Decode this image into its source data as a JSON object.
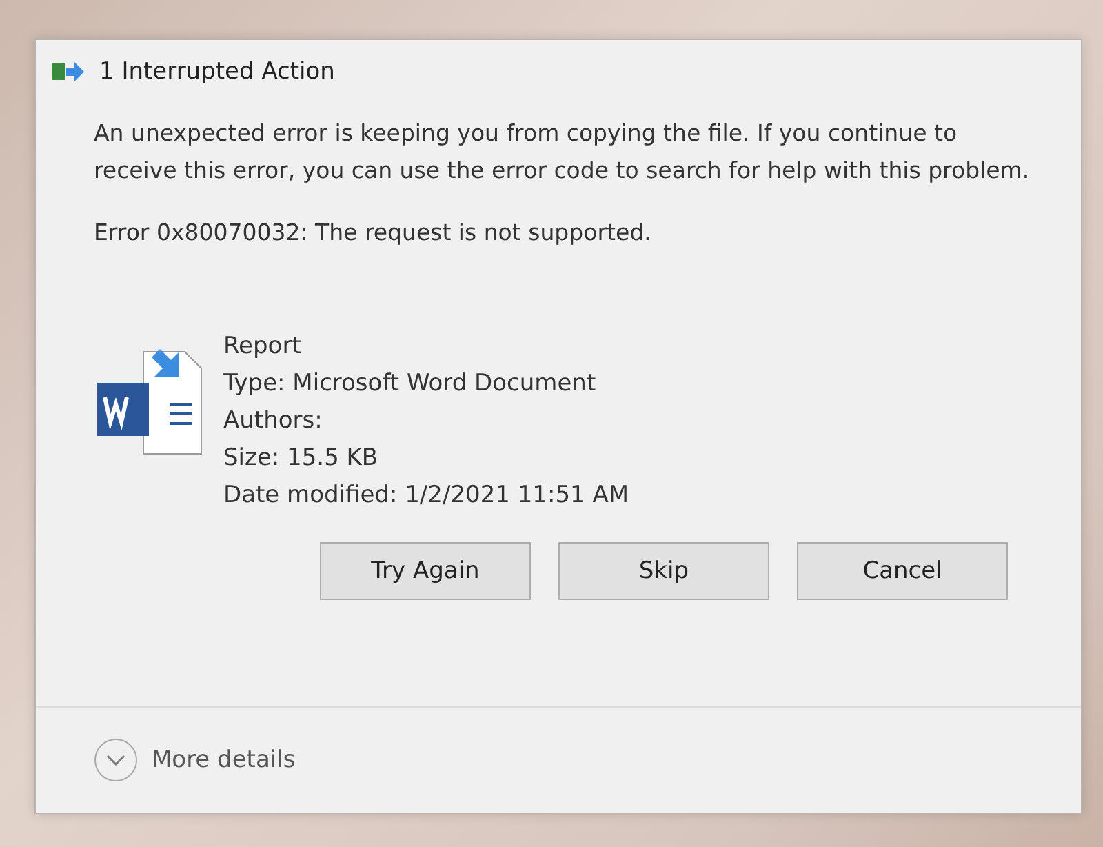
{
  "window": {
    "title": "1 Interrupted Action"
  },
  "message": "An unexpected error is keeping you from copying the file. If you continue to receive this error, you can use the error code to search for help with this problem.",
  "error": "Error 0x80070032: The request is not supported.",
  "file": {
    "name": "Report",
    "details": [
      "Type: Microsoft Word Document",
      "Authors:",
      "Size: 15.5 KB",
      "Date modified: 1/2/2021 11:51 AM"
    ]
  },
  "buttons": [
    {
      "label": "Try Again"
    },
    {
      "label": "Skip"
    },
    {
      "label": "Cancel"
    }
  ],
  "footer": {
    "label": "More details",
    "expanded": false
  }
}
